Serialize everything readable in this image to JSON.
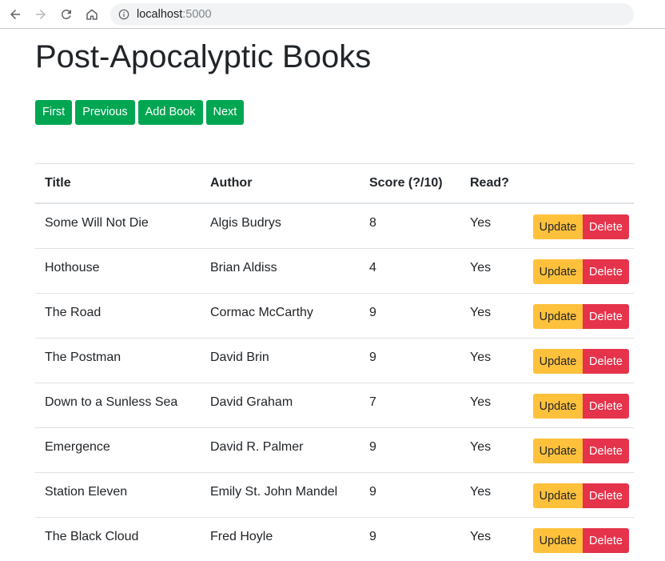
{
  "browser": {
    "url_host": "localhost",
    "url_port": ":5000",
    "icons": [
      "back-arrow-icon",
      "forward-arrow-icon",
      "reload-icon",
      "home-icon",
      "info-icon"
    ]
  },
  "page": {
    "title": "Post-Apocalyptic Books",
    "buttons": {
      "first": "First",
      "previous": "Previous",
      "add_book": "Add Book",
      "next": "Next"
    }
  },
  "table": {
    "headers": {
      "title": "Title",
      "author": "Author",
      "score": "Score (?/10)",
      "read": "Read?"
    },
    "action_labels": {
      "update": "Update",
      "delete": "Delete"
    },
    "rows": [
      {
        "title": "Some Will Not Die",
        "author": "Algis Budrys",
        "score": "8",
        "read": "Yes"
      },
      {
        "title": "Hothouse",
        "author": "Brian Aldiss",
        "score": "4",
        "read": "Yes"
      },
      {
        "title": "The Road",
        "author": "Cormac McCarthy",
        "score": "9",
        "read": "Yes"
      },
      {
        "title": "The Postman",
        "author": "David Brin",
        "score": "9",
        "read": "Yes"
      },
      {
        "title": "Down to a Sunless Sea",
        "author": "David Graham",
        "score": "7",
        "read": "Yes"
      },
      {
        "title": "Emergence",
        "author": "David R. Palmer",
        "score": "9",
        "read": "Yes"
      },
      {
        "title": "Station Eleven",
        "author": "Emily St. John Mandel",
        "score": "9",
        "read": "Yes"
      },
      {
        "title": "The Black Cloud",
        "author": "Fred Hoyle",
        "score": "9",
        "read": "Yes"
      }
    ]
  },
  "colors": {
    "primary_button": "#00a651",
    "update_button": "#ffc13b",
    "delete_button": "#e5334b"
  }
}
